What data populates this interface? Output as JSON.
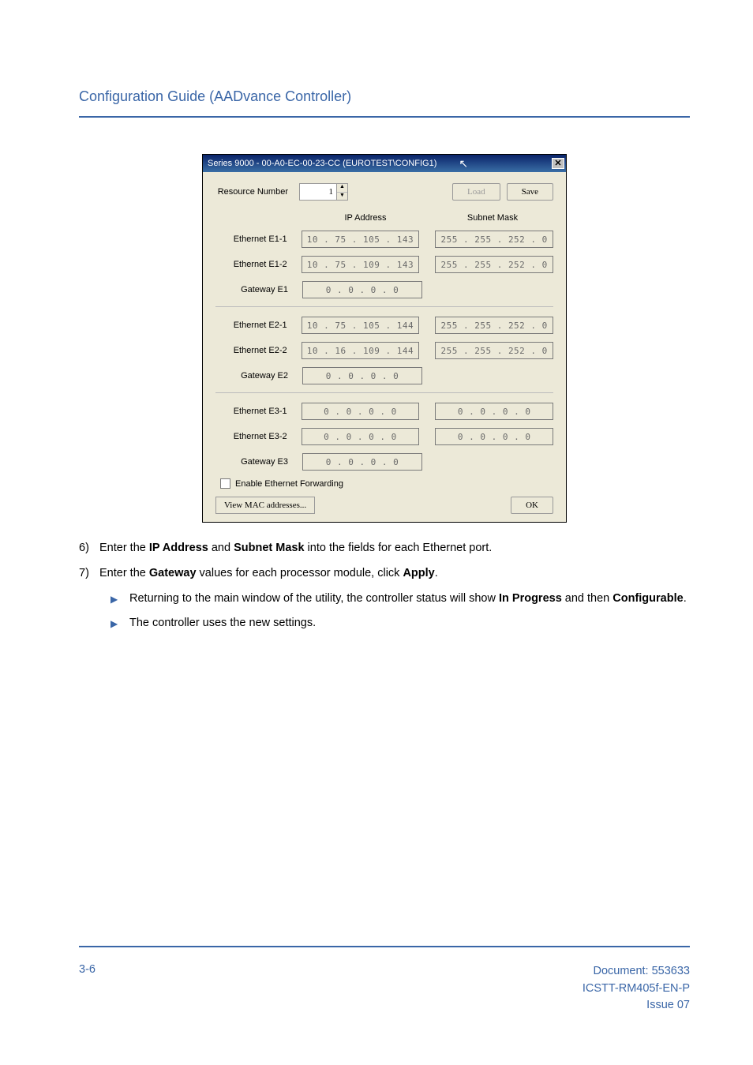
{
  "header": {
    "title": "Configuration Guide (AADvance Controller)"
  },
  "dialog": {
    "title": "Series 9000 - 00-A0-EC-00-23-CC (EUROTEST\\CONFIG1)",
    "resource_label": "Resource Number",
    "resource_value": "1",
    "load_label": "Load",
    "save_label": "Save",
    "col_ip": "IP Address",
    "col_mask": "Subnet Mask",
    "rows": [
      {
        "label": "Ethernet E1-1",
        "ip": "10  .  75  . 105  . 143",
        "mask": "255 . 255 . 252 .  0"
      },
      {
        "label": "Ethernet E1-2",
        "ip": "10  .  75  . 109  . 143",
        "mask": "255 . 255 . 252 .  0"
      },
      {
        "label": "Gateway E1",
        "ip": "0  .  0  .  0  .  0",
        "mask": ""
      },
      {
        "label": "Ethernet E2-1",
        "ip": "10  .  75  . 105  . 144",
        "mask": "255 . 255 . 252 .  0"
      },
      {
        "label": "Ethernet E2-2",
        "ip": "10  .  16  . 109  . 144",
        "mask": "255 . 255 . 252 .  0"
      },
      {
        "label": "Gateway E2",
        "ip": "0  .  0  .  0  .  0",
        "mask": ""
      },
      {
        "label": "Ethernet E3-1",
        "ip": "0  .  0  .  0  .  0",
        "mask": "0  .  0  .  0  .  0"
      },
      {
        "label": "Ethernet E3-2",
        "ip": "0  .  0  .  0  .  0",
        "mask": "0  .  0  .  0  .  0"
      },
      {
        "label": "Gateway E3",
        "ip": "0  .  0  .  0  .  0",
        "mask": ""
      }
    ],
    "enable_fwd": "Enable Ethernet Forwarding",
    "view_mac": "View MAC addresses...",
    "ok_label": "OK"
  },
  "steps": {
    "s6_num": "6)",
    "s6_a": "Enter the ",
    "s6_b": "IP Address",
    "s6_c": " and ",
    "s6_d": "Subnet Mask",
    "s6_e": " into the fields for each Ethernet port.",
    "s7_num": "7)",
    "s7_a": "Enter the ",
    "s7_b": "Gateway",
    "s7_c": " values for each processor module, click ",
    "s7_d": "Apply",
    "s7_e": ".",
    "b1_a": "Returning to the main window of the utility, the controller status will show ",
    "b1_b": "In Progress",
    "b1_c": " and then ",
    "b1_d": "Configurable",
    "b1_e": ".",
    "b2": "The controller uses the new settings."
  },
  "footer": {
    "page": "3-6",
    "doc1": "Document: 553633",
    "doc2": "ICSTT-RM405f-EN-P",
    "doc3": "Issue 07"
  }
}
